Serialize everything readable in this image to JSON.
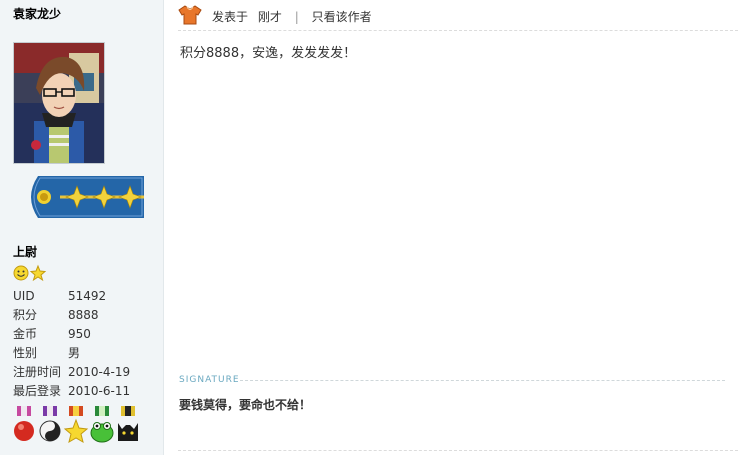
{
  "user": {
    "name": "袁家龙少",
    "rank_title": "上尉",
    "avatar_icon": "avatar-image",
    "rank_badge_icon": "rank-badge-stars",
    "info": [
      {
        "label": "UID",
        "value": "51492"
      },
      {
        "label": "积分",
        "value": "8888"
      },
      {
        "label": "金币",
        "value": "950"
      },
      {
        "label": "性别",
        "value": "男"
      },
      {
        "label": "注册时间",
        "value": "2010-4-19"
      },
      {
        "label": "最后登录",
        "value": "2010-6-11"
      }
    ],
    "medals": [
      "medal-red-ball",
      "medal-yinyang",
      "medal-yellow-star",
      "medal-green-frog",
      "medal-black-cat"
    ]
  },
  "post": {
    "icon": "shirt-icon",
    "posted_label": "发表于",
    "posted_time": "刚才",
    "separator": "|",
    "only_author": "只看该作者",
    "content": "积分8888，安逸，发发发发！"
  },
  "signature": {
    "label": "SIGNATURE",
    "text": "要钱莫得，要命也不给！"
  },
  "colors": {
    "sidebar_bg": "#f1f5f7",
    "signature_label": "#6aa8c0",
    "badge_blue": "#2466a8",
    "shirt_orange": "#e8762a"
  }
}
